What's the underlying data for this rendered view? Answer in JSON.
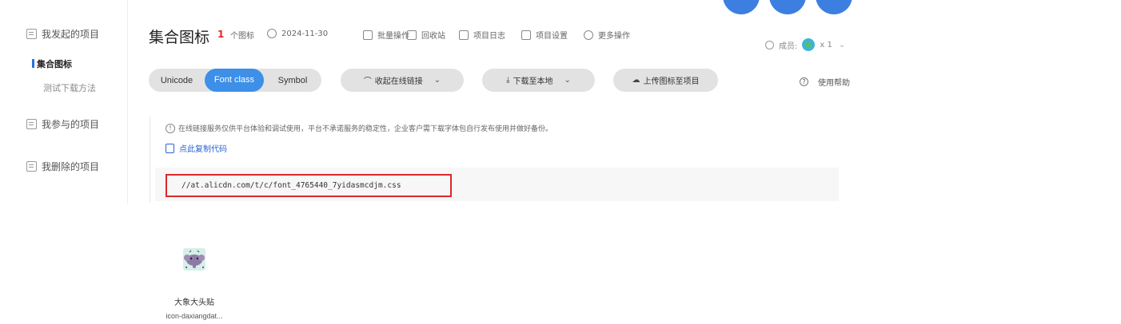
{
  "sidebar": {
    "my_projects": "我发起的项目",
    "active_project": "集合图标",
    "sub_item": "测试下载方法",
    "joined_projects": "我参与的项目",
    "deleted_projects": "我删除的项目"
  },
  "header": {
    "title": "集合图标",
    "count": "1",
    "count_suffix": "个图标",
    "date": "2024-11-30",
    "batch": "批量操作",
    "recycle": "回收站",
    "log": "项目日志",
    "settings": "项目设置",
    "more": "更多操作",
    "members_label": "成员:",
    "members_count": "x 1"
  },
  "toolbar": {
    "tabs": [
      "Unicode",
      "Font class",
      "Symbol"
    ],
    "active_tab": "Font class",
    "collapse": "收起在线链接",
    "download": "下载至本地",
    "upload": "上传图标至项目",
    "help": "使用帮助"
  },
  "notice": {
    "text": "在线链接服务仅供平台体验和调试使用，平台不承诺服务的稳定性，企业客户需下载字体包自行发布使用并做好备份。",
    "copy": "点此复制代码",
    "code": "//at.alicdn.com/t/c/font_4765440_7yidasmcdjm.css"
  },
  "icons": [
    {
      "name": "大象大头贴",
      "code": "icon-daxiangdat..."
    }
  ],
  "colors": {
    "accent": "#3d8fe8",
    "highlight_border": "#d9282b",
    "link": "#2a62d6",
    "count": "#e22222"
  }
}
